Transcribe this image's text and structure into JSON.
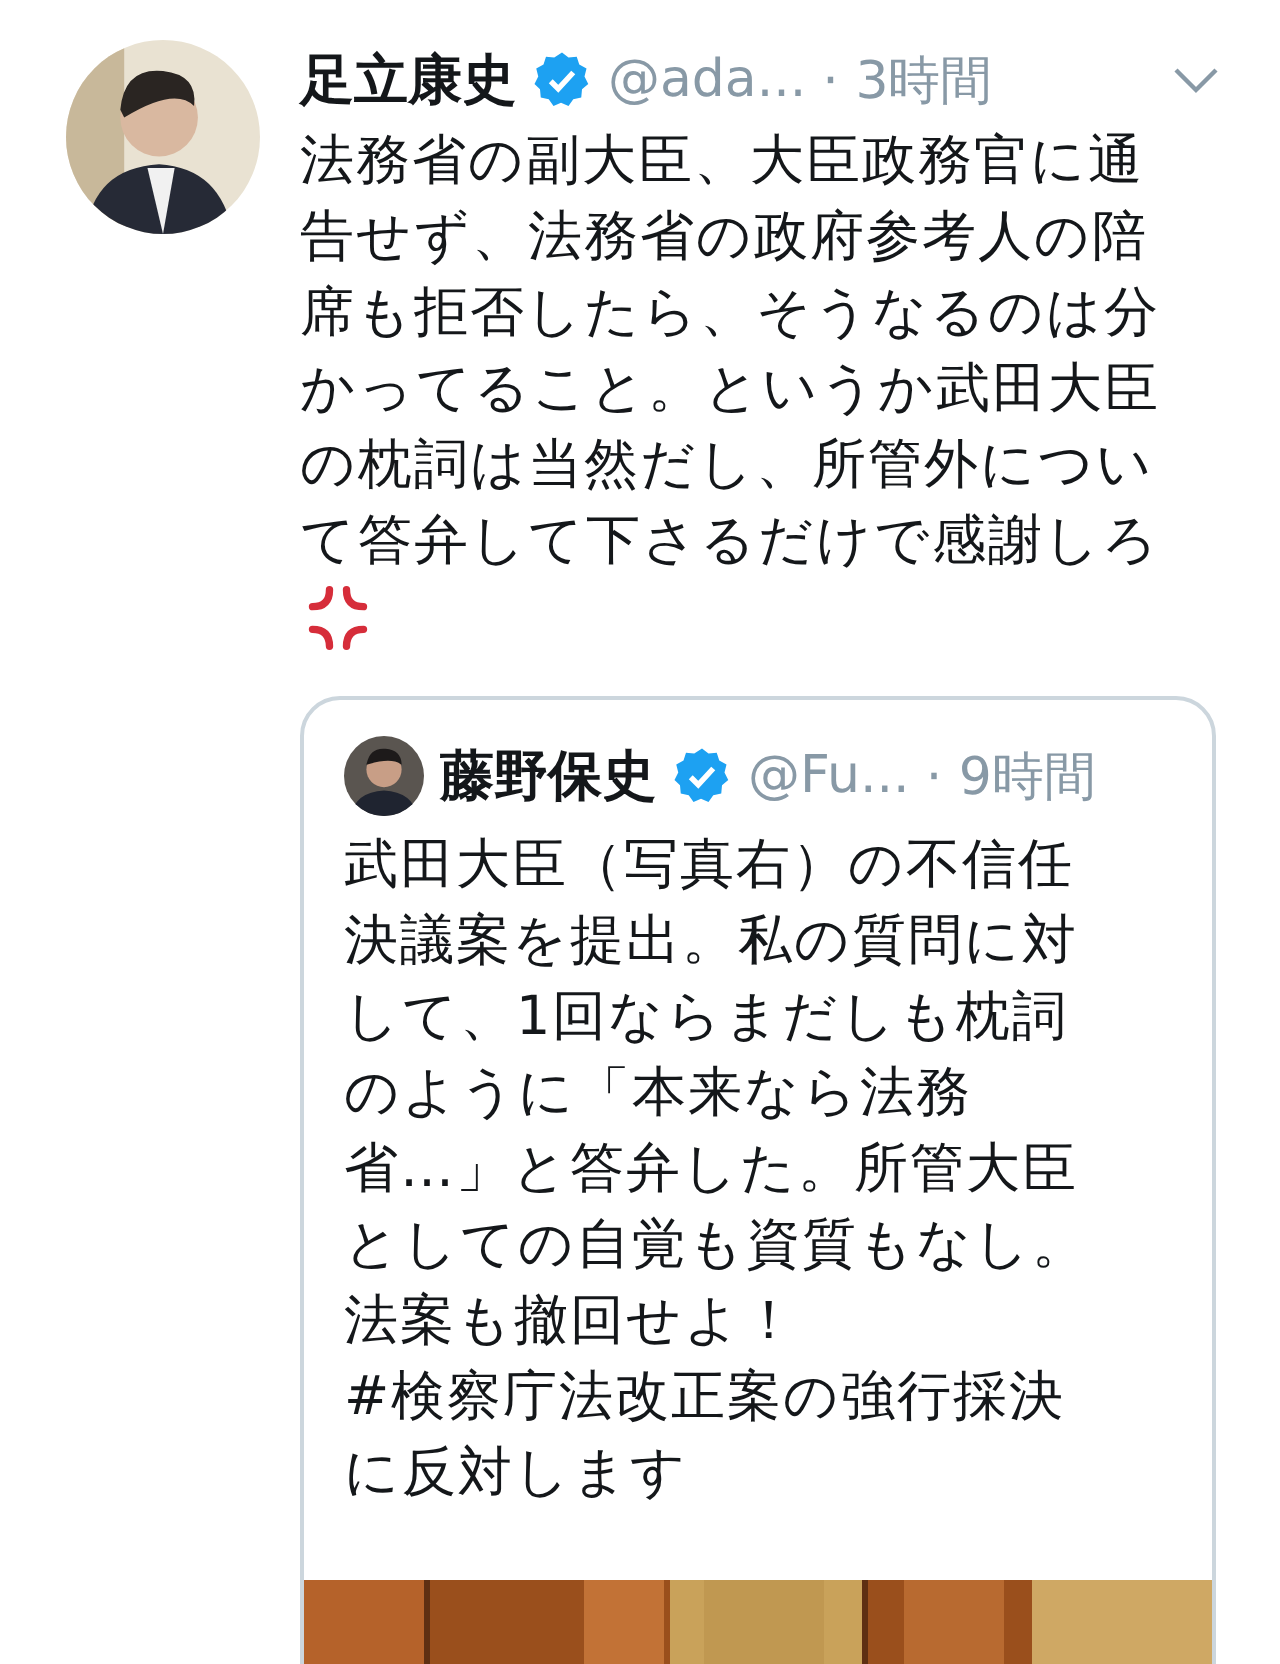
{
  "tweet": {
    "name": "足立康史",
    "verified": true,
    "handle": "@ada...",
    "time": "· 3時間",
    "text": "法務省の副大臣、大臣政務官に通告せず、法務省の政府参考人の陪席も拒否したら、そうなるのは分かってること。というか武田大臣の枕詞は当然だし、所管外について答弁して下さるだけで感謝しろ",
    "quoted": {
      "name": "藤野保史",
      "verified": true,
      "handle": "@Fu...",
      "time": "· 9時間",
      "text": "武田大臣（写真右）の不信任決議案を提出。私の質問に対して、1回ならまだしも枕詞のように「本来なら法務省…」と答弁した。所管大臣としての自覚も資質もなし。法案も撤回せよ！",
      "hashtag": "#検察庁法改正案の強行採決に反対します"
    }
  }
}
